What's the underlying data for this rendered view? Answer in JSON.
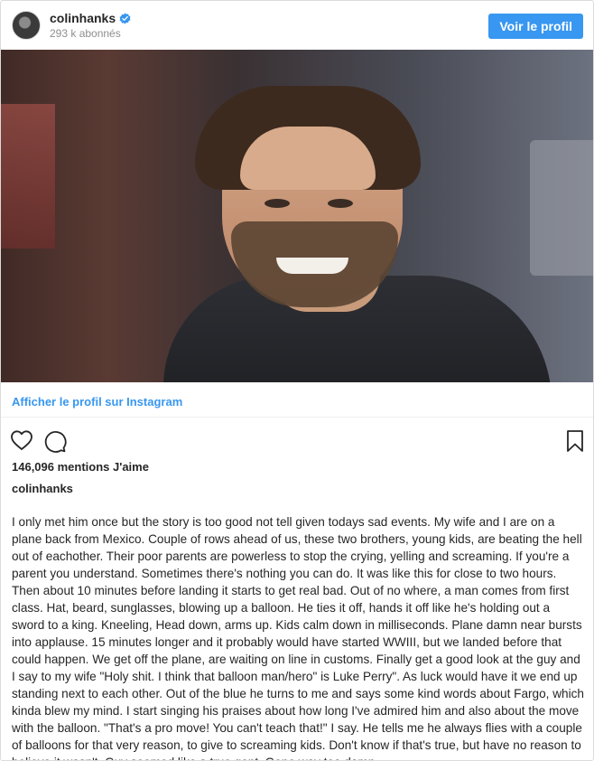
{
  "header": {
    "username": "colinhanks",
    "followers": "293 k abonnés",
    "profile_button": "Voir le profil"
  },
  "photo": {
    "alt": "colinhanks"
  },
  "link": {
    "view_profile": "Afficher le profil sur Instagram"
  },
  "actions": {
    "like_icon": "heart-icon",
    "comment_icon": "comment-icon",
    "save_icon": "bookmark-icon"
  },
  "likes": "146,096 mentions J'aime",
  "caption_user": "colinhanks",
  "caption": "I only met him once but the story is too good not tell given todays sad events. My wife and I are on a plane back from Mexico. Couple of rows ahead of us, these two brothers, young kids, are beating the hell out of eachother. Their poor parents are powerless to stop the crying, yelling and screaming. If you're a parent you understand. Sometimes there's nothing you can do. It was like this for close to two hours. Then about 10 minutes before landing it starts to get real bad. Out of no where, a man comes from first class. Hat, beard, sunglasses, blowing up a balloon. He ties it off, hands it off like he's holding out a sword to a king. Kneeling, Head down, arms up. Kids calm down in milliseconds. Plane damn near bursts into applause. 15 minutes longer and it probably would have started WWIII, but we landed before that could happen. We get off the plane, are waiting on line in customs. Finally get a good look at the guy and I say to my wife \"Holy shit. I think that balloon man/hero\" is Luke Perry\". As luck would have it we end up standing next to each other. Out of the blue he turns to me and says some kind words about Fargo, which kinda blew my mind. I start singing his praises about how long I've admired him and also about the move with the balloon. \"That's a pro move! You can't teach that!\" I say. He tells me he always flies with a couple of balloons for that very reason, to give to screaming kids. Don't know if that's true, but have no reason to believe it wasn't. Guy seemed like a true gent. Gone way too damn",
  "colors": {
    "accent": "#3897f0",
    "text": "#262626",
    "muted": "#8e8e8e",
    "border": "#dbdbdb"
  }
}
